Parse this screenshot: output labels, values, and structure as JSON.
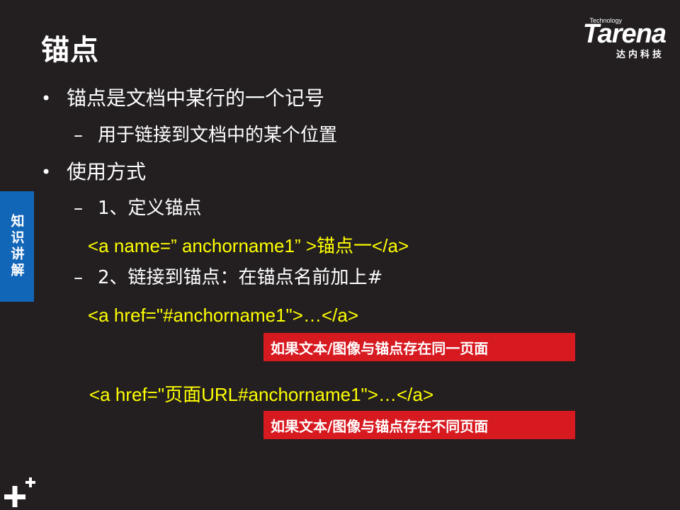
{
  "slide": {
    "title": "锚点",
    "side_tab": "知识讲解",
    "logo": {
      "tech": "Technology",
      "main": "Tarena",
      "sub": "达内科技"
    },
    "bullets": [
      {
        "text": "锚点是文档中某行的一个记号"
      },
      {
        "text": "使用方式"
      }
    ],
    "subs": [
      {
        "text": "用于链接到文档中的某个位置"
      },
      {
        "text": "1、定义锚点"
      },
      {
        "text": "2、链接到锚点：在锚点名前加上#"
      }
    ],
    "code_lines": [
      {
        "text": "<a name=” anchorname1” >锚点一</a>"
      },
      {
        "text": "<a href=\"#anchorname1\">…</a>"
      },
      {
        "text": "<a href=\"页面URL#anchorname1\">…</a>"
      }
    ],
    "notes": [
      {
        "text": "如果文本/图像与锚点存在同一页面"
      },
      {
        "text": "如果文本/图像与锚点存在不同页面"
      }
    ],
    "bullet_marker": "•",
    "sub_marker": "–",
    "colors": {
      "background": "#231f20",
      "code": "#ffff00",
      "note_bg": "#d71920",
      "side_tab": "#1266b8"
    },
    "icons": [
      "plus-icon"
    ]
  }
}
